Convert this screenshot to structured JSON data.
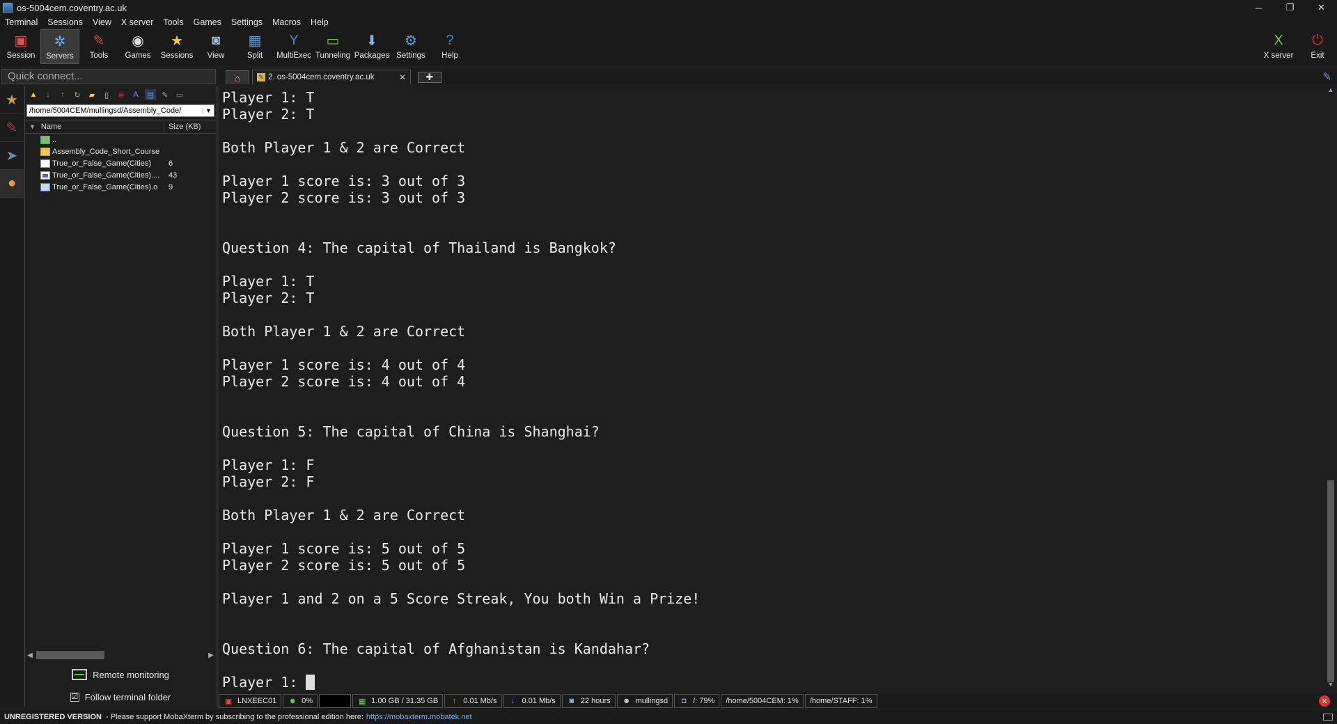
{
  "window": {
    "title": "os-5004cem.coventry.ac.uk",
    "controls": [
      "─",
      "❐",
      "✕"
    ]
  },
  "menu": [
    "Terminal",
    "Sessions",
    "View",
    "X server",
    "Tools",
    "Games",
    "Settings",
    "Macros",
    "Help"
  ],
  "toolbar": {
    "tools": [
      {
        "label": "Session",
        "icon": "session-icon",
        "glyph": "▣",
        "color": "#e05050"
      },
      {
        "label": "Servers",
        "icon": "servers-icon",
        "glyph": "✲",
        "color": "#6ab0ff",
        "active": true
      },
      {
        "label": "Tools",
        "icon": "tools-icon",
        "glyph": "✎",
        "color": "#e04040"
      },
      {
        "label": "Games",
        "icon": "games-icon",
        "glyph": "◉",
        "color": "#dddddd"
      },
      {
        "label": "Sessions",
        "icon": "star-icon",
        "glyph": "★",
        "color": "#f2c84a"
      },
      {
        "label": "View",
        "icon": "view-icon",
        "glyph": "◙",
        "color": "#9ab8d8"
      },
      {
        "label": "Split",
        "icon": "split-icon",
        "glyph": "▦",
        "color": "#5a9ad8"
      },
      {
        "label": "MultiExec",
        "icon": "multiexec-icon",
        "glyph": "Y",
        "color": "#6a7ad8"
      },
      {
        "label": "Tunneling",
        "icon": "tunneling-icon",
        "glyph": "▭",
        "color": "#7cc06a"
      },
      {
        "label": "Packages",
        "icon": "packages-icon",
        "glyph": "⬇",
        "color": "#8ab0e8"
      },
      {
        "label": "Settings",
        "icon": "gear-icon",
        "glyph": "⚙",
        "color": "#5a9ad8"
      },
      {
        "label": "Help",
        "icon": "help-icon",
        "glyph": "?",
        "color": "#3a8ae8"
      }
    ],
    "right_tools": [
      {
        "label": "X server",
        "icon": "xserver-icon",
        "glyph": "X",
        "color": "#7cc06a"
      },
      {
        "label": "Exit",
        "icon": "power-icon",
        "glyph": "⏻",
        "color": "#e03030"
      }
    ]
  },
  "quick_connect": {
    "placeholder": "Quick connect..."
  },
  "tabs": {
    "session_label": "2. os-5004cem.coventry.ac.uk",
    "close": "✕",
    "add": "✚"
  },
  "file_browser": {
    "path": "/home/5004CEM/mullingsd/Assembly_Code/",
    "columns": {
      "name": "Name",
      "size": "Size (KB)"
    },
    "files": [
      {
        "name": "..",
        "size": "",
        "type": "up"
      },
      {
        "name": "Assembly_Code_Short_Course",
        "size": "",
        "type": "folder"
      },
      {
        "name": "True_or_False_Game(Cities)",
        "size": "6",
        "type": "file"
      },
      {
        "name": "True_or_False_Game(Cities)....",
        "size": "43",
        "type": "exe"
      },
      {
        "name": "True_or_False_Game(Cities).o",
        "size": "9",
        "type": "obj"
      }
    ],
    "remote_monitoring": "Remote monitoring",
    "follow_terminal": "Follow terminal folder",
    "follow_checked": "☑"
  },
  "terminal": {
    "lines": [
      "Player 1: T",
      "Player 2: T",
      "",
      "Both Player 1 & 2 are Correct",
      "",
      "Player 1 score is: 3 out of 3",
      "Player 2 score is: 3 out of 3",
      "",
      "",
      "Question 4: The capital of Thailand is Bangkok?",
      "",
      "Player 1: T",
      "Player 2: T",
      "",
      "Both Player 1 & 2 are Correct",
      "",
      "Player 1 score is: 4 out of 4",
      "Player 2 score is: 4 out of 4",
      "",
      "",
      "Question 5: The capital of China is Shanghai?",
      "",
      "Player 1: F",
      "Player 2: F",
      "",
      "Both Player 1 & 2 are Correct",
      "",
      "Player 1 score is: 5 out of 5",
      "Player 2 score is: 5 out of 5",
      "",
      "Player 1 and 2 on a 5 Score Streak, You both Win a Prize!",
      "",
      "",
      "Question 6: The capital of Afghanistan is Kandahar?",
      ""
    ],
    "prompt": "Player 1: "
  },
  "status": {
    "host": "LNXEEC01",
    "cpu": "0%",
    "memory": "1.00 GB / 31.35 GB",
    "upload": "0.01 Mb/s",
    "download": "0.01 Mb/s",
    "uptime": "22 hours",
    "user": "mullingsd",
    "disk_root": "/: 79%",
    "disk_home": "/home/5004CEM: 1%",
    "disk_staff": "/home/STAFF: 1%"
  },
  "bottom": {
    "unregistered": "UNREGISTERED VERSION",
    "message": "-  Please support MobaXterm by subscribing to the professional edition here:",
    "link": "https://mobaxterm.mobatek.net"
  }
}
